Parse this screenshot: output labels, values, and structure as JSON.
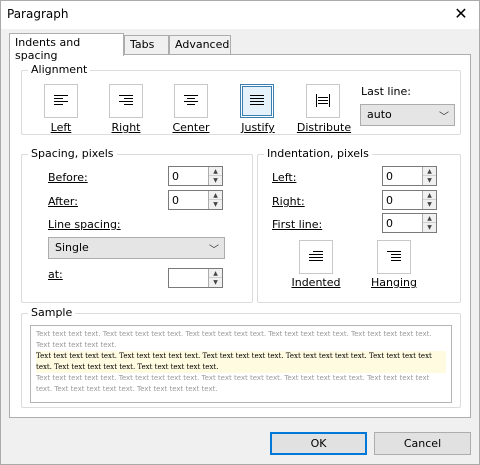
{
  "window": {
    "title": "Paragraph"
  },
  "tabs": [
    "Indents and spacing",
    "Tabs",
    "Advanced"
  ],
  "alignment": {
    "label": "Alignment",
    "buttons": [
      "Left",
      "Right",
      "Center",
      "Justify",
      "Distribute"
    ],
    "selected": "Justify",
    "last_line_label": "Last line:",
    "last_line_value": "auto"
  },
  "spacing": {
    "label": "Spacing, pixels",
    "before_label": "Before:",
    "before_value": "0",
    "after_label": "After:",
    "after_value": "0",
    "line_spacing_label": "Line spacing:",
    "line_spacing_value": "Single",
    "at_label": "at:",
    "at_value": ""
  },
  "indentation": {
    "label": "Indentation, pixels",
    "left_label": "Left:",
    "left_value": "0",
    "right_label": "Right:",
    "right_value": "0",
    "first_line_label": "First line:",
    "first_line_value": "0",
    "indented_label": "Indented",
    "hanging_label": "Hanging"
  },
  "sample": {
    "label": "Sample",
    "before_text": "Text text text text. Text text text text text. Text text text text text. Text text text text text. Text text text text text. Text text text text text.",
    "main_text": "Text text text text text. Text text text text text. Text text text text text. Text text text text text. Text text text text text. Text text text text text. Text text text text text.",
    "after_text": "Text text text text text. Text text text text text. Text text text text text. Text text text text text. Text text text text text. Text text text text text. Text text text text text."
  },
  "buttons": {
    "ok": "OK",
    "cancel": "Cancel"
  }
}
